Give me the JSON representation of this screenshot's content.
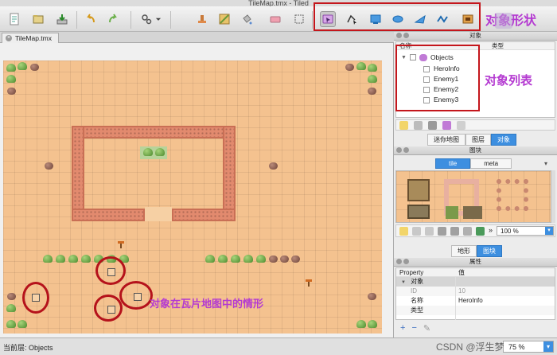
{
  "window": {
    "title": "TileMap.tmx - Tiled"
  },
  "document_tab": {
    "label": "TileMap.tmx"
  },
  "annotations": {
    "shapes": "对象形状",
    "list": "对象列表",
    "map": "对象在瓦片地图中的情形"
  },
  "objects_panel": {
    "title": "对象",
    "col_name": "名称",
    "col_type": "类型",
    "layer": "Objects",
    "items": [
      "HeroInfo",
      "Enemy1",
      "Enemy2",
      "Enemy3"
    ],
    "tabs": [
      "迷你地图",
      "图层",
      "对象"
    ],
    "active_tab": "对象"
  },
  "tileset_panel": {
    "title": "图块",
    "tabs": [
      "tile",
      "meta"
    ],
    "active_tab": "tile",
    "zoom": "100 %",
    "bottom_tabs": [
      "地形",
      "图块"
    ],
    "active_bottom_tab": "图块"
  },
  "properties_panel": {
    "title": "属性",
    "col_property": "Property",
    "col_value": "值",
    "group": "对象",
    "rows": [
      {
        "name": "ID",
        "value": "10"
      },
      {
        "name": "名称",
        "value": "HeroInfo"
      },
      {
        "name": "类型",
        "value": ""
      }
    ]
  },
  "status_bar": {
    "current_layer": "当前层: Objects",
    "zoom": "75 %"
  },
  "watermark": "CSDN @浮生梦",
  "colors": {
    "accent": "#3d8fe0",
    "annotation": "#b43ad1",
    "highlight": "#c4161c",
    "ground": "#f4c28f"
  }
}
